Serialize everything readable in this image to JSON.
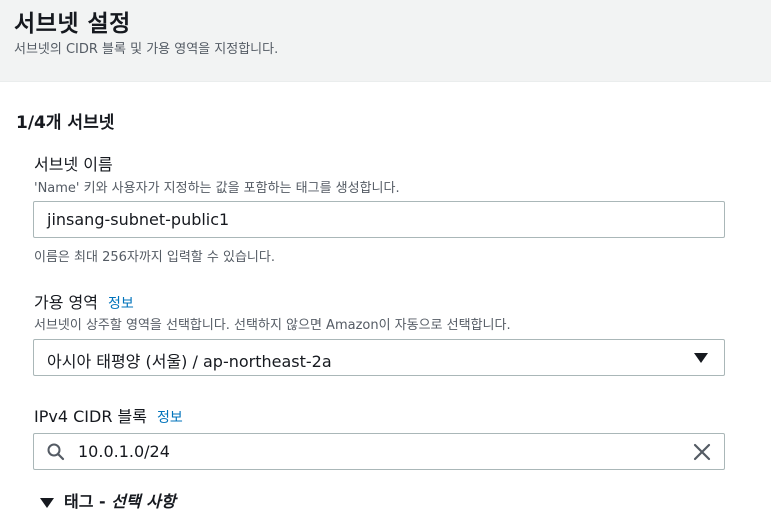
{
  "header": {
    "title": "서브넷 설정",
    "description": "서브넷의 CIDR 블록 및 가용 영역을 지정합니다."
  },
  "subnet": {
    "section_title": "1/4개 서브넷",
    "name": {
      "label": "서브넷 이름",
      "hint": "'Name' 키와 사용자가 지정하는 값을 포함하는 태그를 생성합니다.",
      "value": "jinsang-subnet-public1",
      "constraint": "이름은 최대 256자까지 입력할 수 있습니다."
    },
    "az": {
      "label": "가용 영역",
      "info": "정보",
      "hint": "서브넷이 상주할 영역을 선택합니다. 선택하지 않으면 Amazon이 자동으로 선택합니다.",
      "selected": "아시아 태평양 (서울) / ap-northeast-2a"
    },
    "cidr": {
      "label": "IPv4 CIDR 블록",
      "info": "정보",
      "value": "10.0.1.0/24"
    },
    "tags": {
      "label": "태그 - ",
      "optional": "선택 사항"
    }
  },
  "icons": {
    "search": "search-icon",
    "clear": "close-icon",
    "caret": "caret-down-icon"
  }
}
